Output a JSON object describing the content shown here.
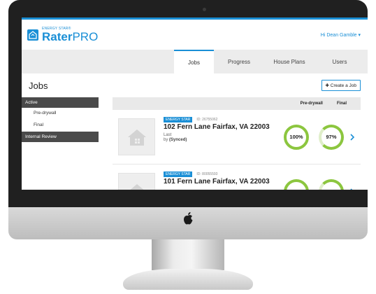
{
  "app": {
    "logo_small": "ENERGY STAR®",
    "logo_name": "Rater",
    "logo_suffix": "PRO",
    "greeting": "Hi Dean Gamble ▾",
    "brand_color": "#1a8fd6",
    "progress_color": "#8cc63f"
  },
  "tabs": [
    {
      "label": "Jobs",
      "active": true
    },
    {
      "label": "Progress",
      "active": false
    },
    {
      "label": "House Plans",
      "active": false
    },
    {
      "label": "Users",
      "active": false
    }
  ],
  "page": {
    "title": "Jobs",
    "create_label": "Create a Job",
    "create_icon": "plus-icon"
  },
  "sidebar": {
    "groups": [
      {
        "label": "Active",
        "items": [
          "Pre-drywall",
          "Final"
        ]
      },
      {
        "label": "Internal Review",
        "items": []
      }
    ]
  },
  "table": {
    "columns": [
      "Pre-drywall",
      "Final"
    ]
  },
  "jobs": [
    {
      "badge": "ENERGY STAR",
      "id_text": "ID: 26755062",
      "address": "102 Fern Lane Fairfax, VA 22003",
      "meta_line1": "Last",
      "meta_prefix": "by",
      "meta_status": "(Synced)",
      "pre_drywall": "100%",
      "final": "97%",
      "final_fraction": 0.97
    },
    {
      "badge": "ENERGY STAR",
      "id_text": "ID: 80055593",
      "address": "101 Fern Lane Fairfax, VA 22003",
      "meta_line1": "",
      "meta_prefix": "",
      "meta_status": "",
      "pre_drywall": "",
      "final": "",
      "final_fraction": null
    }
  ]
}
